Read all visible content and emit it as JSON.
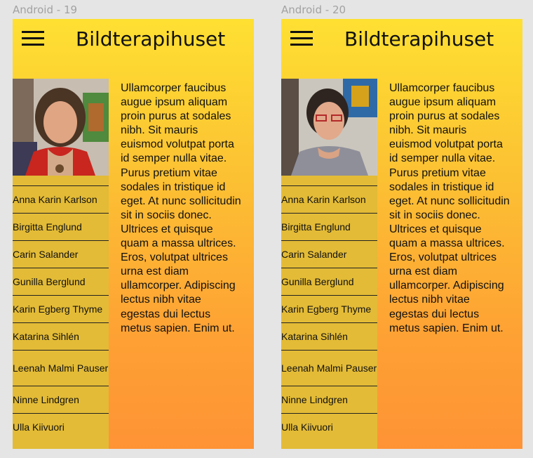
{
  "artboards": [
    {
      "label": "Android - 19",
      "app_title": "Bildterapihuset",
      "menu_icon": "hamburger-menu-icon",
      "photo_alt": "portrait-photo",
      "names": [
        "Anna Karin Karlson",
        "Birgitta Englund",
        "Carin Salander",
        "Gunilla Berglund",
        "Karin Egberg Thyme",
        "Katarina Sihlén",
        "Leenah Malmi Pauser",
        "Ninne Lindgren",
        "Ulla Kiivuori"
      ],
      "body_text": "Ullamcorper faucibus augue ipsum aliquam proin purus at sodales nibh. Sit mauris euismod volutpat porta id semper nulla vitae. Purus pretium vitae sodales in tristique id eget. At nunc sollicitudin sit in sociis donec. Ultrices et quisque quam a massa ultrices. Eros, volutpat ultrices urna est diam ullamcorper. Adipiscing lectus nibh vitae egestas dui lectus metus sapien. Enim ut."
    },
    {
      "label": "Android - 20",
      "app_title": "Bildterapihuset",
      "menu_icon": "hamburger-menu-icon",
      "photo_alt": "portrait-photo",
      "names": [
        "Anna Karin Karlson",
        "Birgitta Englund",
        "Carin Salander",
        "Gunilla Berglund",
        "Karin Egberg Thyme",
        "Katarina Sihlén",
        "Leenah Malmi Pauser",
        "Ninne Lindgren",
        "Ulla Kiivuori"
      ],
      "body_text": "Ullamcorper faucibus augue ipsum aliquam proin purus at sodales nibh. Sit mauris euismod volutpat porta id semper nulla vitae. Purus pretium vitae sodales in tristique id eget. At nunc sollicitudin sit in sociis donec. Ultrices et quisque quam a massa ultrices. Eros, volutpat ultrices urna est diam ullamcorper. Adipiscing lectus nibh vitae egestas dui lectus metus sapien. Enim ut."
    }
  ],
  "colors": {
    "background": "#e5e5e5",
    "gradient_top": "#fee032",
    "gradient_bottom": "#fe9335",
    "sidebar": "#e3bb36",
    "text": "#111111"
  }
}
